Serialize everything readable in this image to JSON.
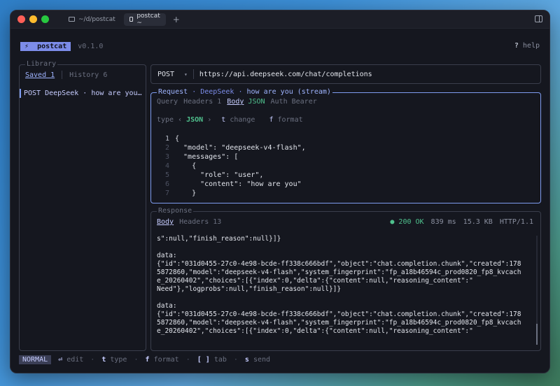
{
  "window": {
    "tabs": [
      {
        "label": "~/d/postcat",
        "active": false
      },
      {
        "label": "postcat ~",
        "active": true
      }
    ],
    "new_tab": "+"
  },
  "app": {
    "logo_glyph": "⚡",
    "name": "postcat",
    "version": "v0.1.0",
    "help_key": "?",
    "help_label": "help"
  },
  "library": {
    "legend": "Library",
    "tabs": [
      {
        "label": "Saved 1",
        "active": true
      },
      {
        "label": "History 6",
        "active": false
      }
    ],
    "items": [
      {
        "label": "POST DeepSeek · how are you…"
      }
    ]
  },
  "url_bar": {
    "method": "POST",
    "method_chevron": "▾",
    "url": "https://api.deepseek.com/chat/completions"
  },
  "request": {
    "title_word": "Request",
    "dot": "·",
    "collection": "DeepSeek",
    "name": "how are you (stream)",
    "tabs": [
      {
        "label": "Query",
        "active": false
      },
      {
        "label": "Headers 1",
        "active": false
      },
      {
        "label": "Body",
        "active": true
      },
      {
        "label": "JSON",
        "active": false
      },
      {
        "label": "Auth Bearer",
        "active": false
      }
    ],
    "type_label": "type",
    "type_left": "‹",
    "type_value": "JSON",
    "type_right": "›",
    "change_key": "t",
    "change_label": "change",
    "format_key": "f",
    "format_label": "format",
    "code": [
      {
        "n": "1",
        "text": "{"
      },
      {
        "n": "2",
        "text": "  \"model\": \"deepseek-v4-flash\","
      },
      {
        "n": "3",
        "text": "  \"messages\": ["
      },
      {
        "n": "4",
        "text": "    {"
      },
      {
        "n": "5",
        "text": "      \"role\": \"user\","
      },
      {
        "n": "6",
        "text": "      \"content\": \"how are you\""
      },
      {
        "n": "7",
        "text": "    }"
      }
    ]
  },
  "response": {
    "legend": "Response",
    "tabs": [
      {
        "label": "Body",
        "active": true
      },
      {
        "label": "Headers 13",
        "active": false
      }
    ],
    "status_dot": "●",
    "status": "200 OK",
    "time": "839 ms",
    "size": "15.3 KB",
    "protocol": "HTTP/1.1",
    "body_lines": [
      "s\":null,\"finish_reason\":null}]}",
      "",
      "data:",
      "{\"id\":\"031d0455-27c0-4e98-bcde-ff338c666bdf\",\"object\":\"chat.completion.chunk\",\"created\":178",
      "5872860,\"model\":\"deepseek-v4-flash\",\"system_fingerprint\":\"fp_a18b46594c_prod0820_fp8_kvcach",
      "e_20260402\",\"choices\":[{\"index\":0,\"delta\":{\"content\":null,\"reasoning_content\":\"",
      "Need\"},\"logprobs\":null,\"finish_reason\":null}]}",
      "",
      "data:",
      "{\"id\":\"031d0455-27c0-4e98-bcde-ff338c666bdf\",\"object\":\"chat.completion.chunk\",\"created\":178",
      "5872860,\"model\":\"deepseek-v4-flash\",\"system_fingerprint\":\"fp_a18b46594c_prod0820_fp8_kvcach",
      "e_20260402\",\"choices\":[{\"index\":0,\"delta\":{\"content\":null,\"reasoning_content\":\""
    ]
  },
  "footer": {
    "mode": "NORMAL",
    "items": [
      {
        "key": "⏎",
        "label": "edit"
      },
      {
        "key": "t",
        "label": "type"
      },
      {
        "key": "f",
        "label": "format"
      },
      {
        "key": "[ ]",
        "label": "tab"
      },
      {
        "key": "s",
        "label": "send"
      }
    ]
  }
}
